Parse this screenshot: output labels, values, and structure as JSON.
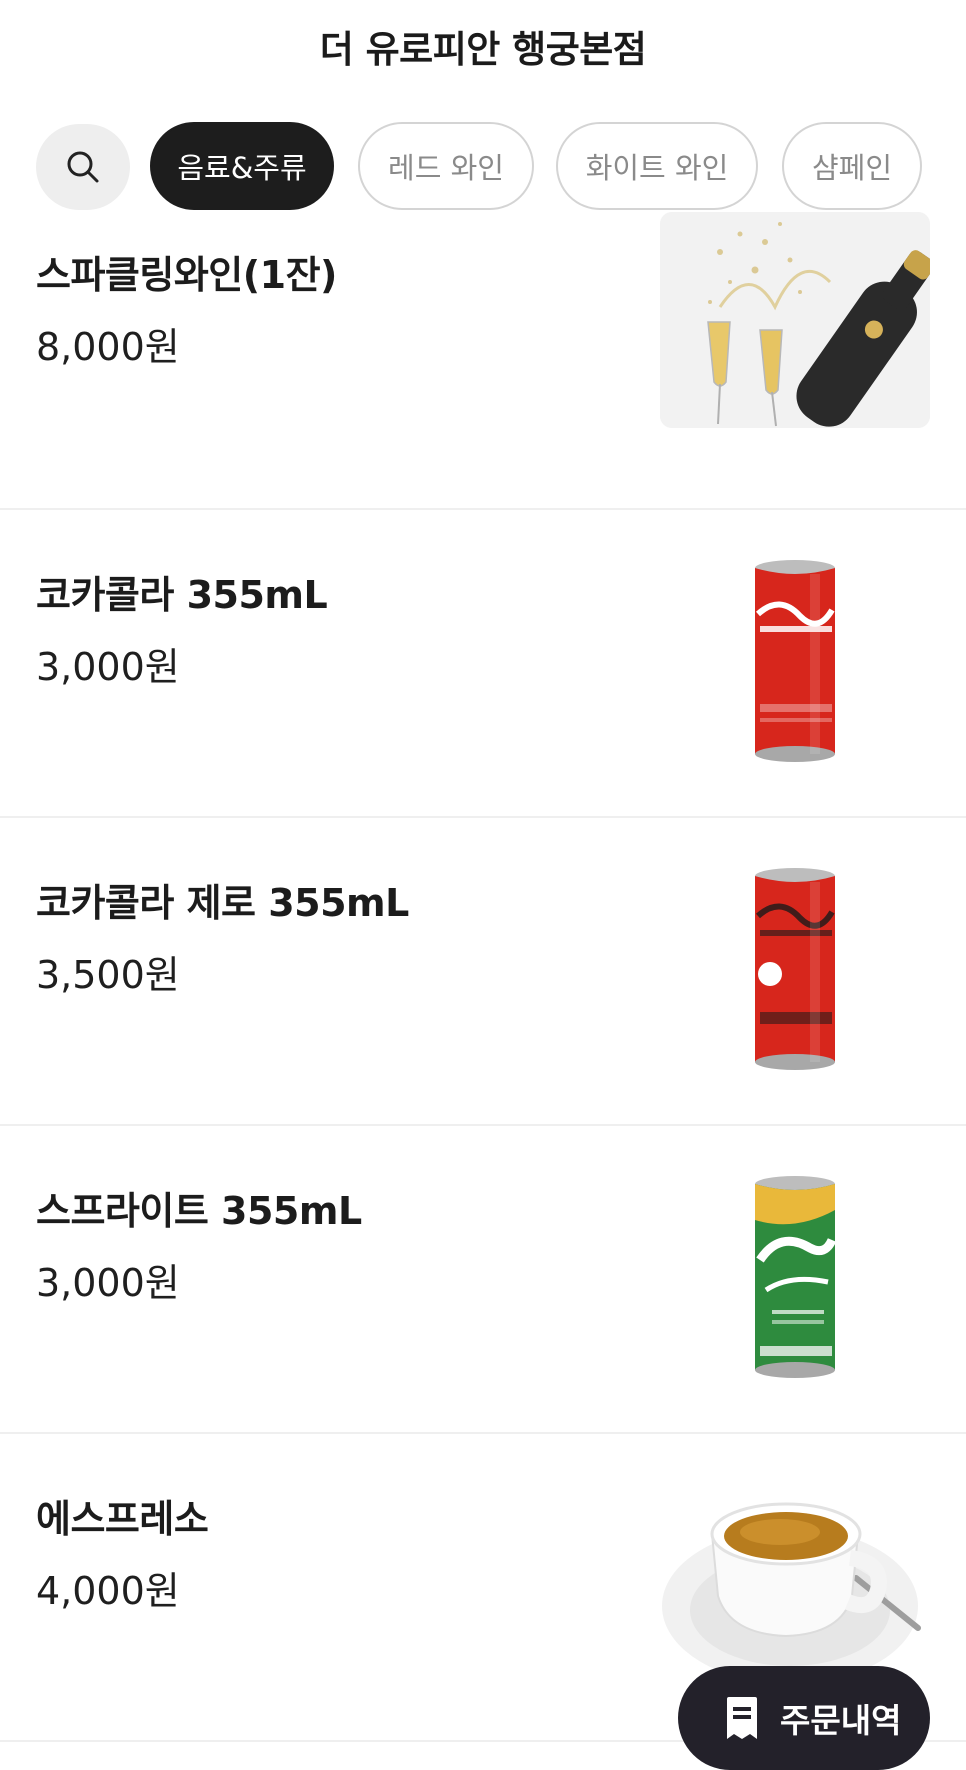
{
  "header": {
    "title": "더 유로피안 행궁본점"
  },
  "tabs": {
    "search_icon": "search-icon",
    "items": [
      {
        "label": "음료&주류",
        "active": true
      },
      {
        "label": "레드 와인",
        "active": false
      },
      {
        "label": "화이트 와인",
        "active": false
      },
      {
        "label": "샴페인",
        "active": false
      }
    ]
  },
  "menu": {
    "items": [
      {
        "name": "스파클링와인(1잔)",
        "price": "8,000원",
        "image": "sparkling-wine-image"
      },
      {
        "name": "코카콜라 355mL",
        "price": "3,000원",
        "image": "coca-cola-can-image"
      },
      {
        "name": "코카콜라 제로 355mL",
        "price": "3,500원",
        "image": "coca-cola-zero-can-image"
      },
      {
        "name": "스프라이트 355mL",
        "price": "3,000원",
        "image": "sprite-can-image"
      },
      {
        "name": "에스프레소",
        "price": "4,000원",
        "image": "espresso-cup-image"
      }
    ]
  },
  "order_button": {
    "label": "주문내역",
    "icon": "receipt-icon"
  },
  "colors": {
    "active_chip": "#1d1d1d",
    "order_button": "#23212a",
    "coke_red": "#d7261c",
    "sprite_green": "#2e8b3e"
  }
}
